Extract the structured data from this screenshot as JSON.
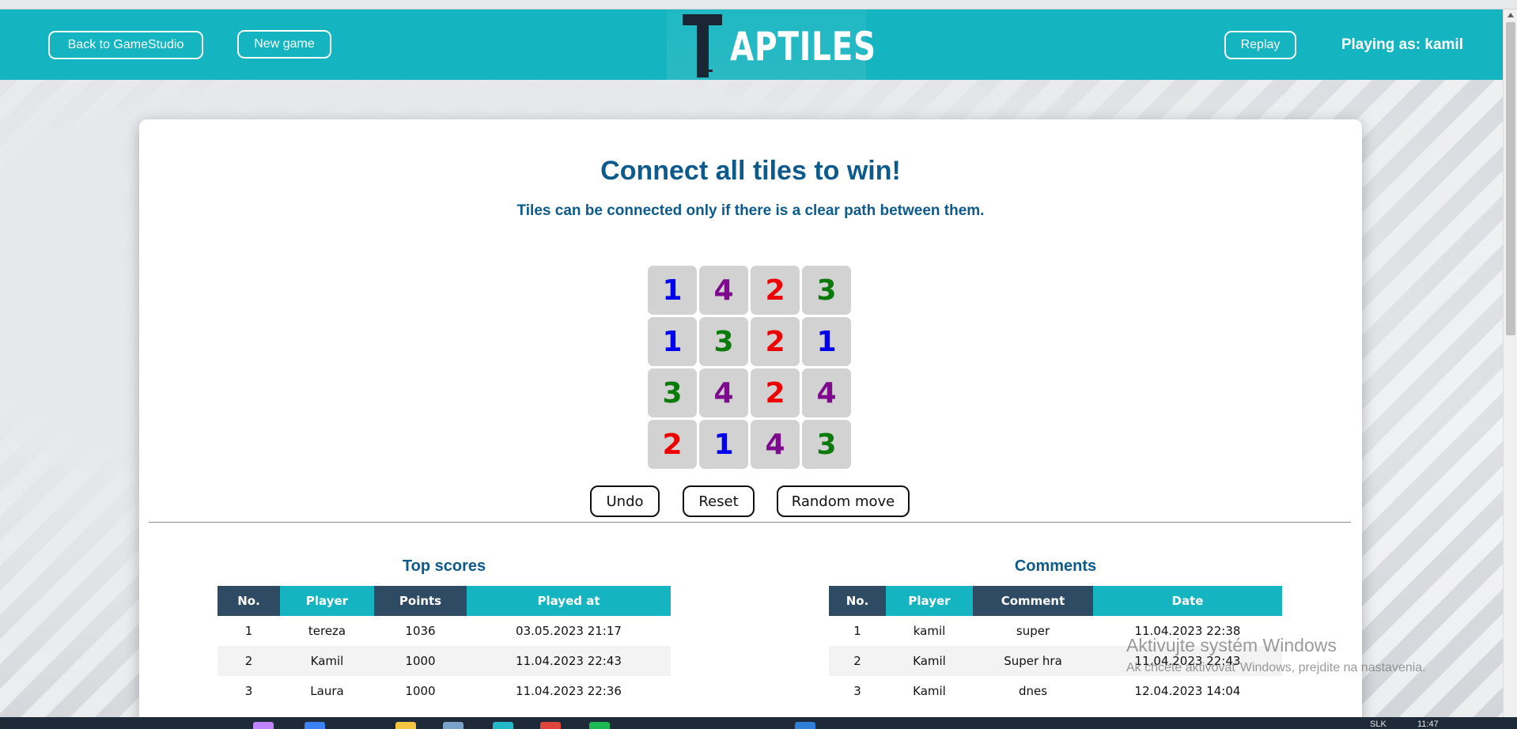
{
  "header": {
    "back_label": "Back to GameStudio",
    "new_game_label": "New game",
    "logo_text": "APTILES",
    "logo_letter": "T",
    "replay_label": "Replay",
    "playing_as": "Playing as: kamil"
  },
  "game": {
    "title": "Connect all tiles to win!",
    "subtitle": "Tiles can be connected only if there is a clear path between them.",
    "tiles": [
      [
        1,
        4,
        2,
        3
      ],
      [
        1,
        3,
        2,
        1
      ],
      [
        3,
        4,
        2,
        4
      ],
      [
        2,
        1,
        4,
        3
      ]
    ],
    "tile_colors": {
      "1": "#0000ee",
      "2": "#ee0000",
      "3": "#0a7a0a",
      "4": "#7d0a8c"
    },
    "buttons": {
      "undo": "Undo",
      "reset": "Reset",
      "random": "Random move"
    }
  },
  "scores": {
    "title": "Top scores",
    "columns": [
      "No.",
      "Player",
      "Points",
      "Played at"
    ],
    "rows": [
      [
        "1",
        "tereza",
        "1036",
        "03.05.2023 21:17"
      ],
      [
        "2",
        "Kamil",
        "1000",
        "11.04.2023 22:43"
      ],
      [
        "3",
        "Laura",
        "1000",
        "11.04.2023 22:36"
      ]
    ]
  },
  "comments": {
    "title": "Comments",
    "columns": [
      "No.",
      "Player",
      "Comment",
      "Date"
    ],
    "rows": [
      [
        "1",
        "kamil",
        "super",
        "11.04.2023 22:38"
      ],
      [
        "2",
        "Kamil",
        "Super hra",
        "11.04.2023 22:43"
      ],
      [
        "3",
        "Kamil",
        "dnes",
        "12.04.2023 14:04"
      ]
    ]
  },
  "watermark": {
    "line1": "Aktivujte systém Windows",
    "line2": "Ak chcete aktivovať Windows, prejdite na nastavenia."
  },
  "taskbar": {
    "lang": "SLK",
    "time": "11:47"
  }
}
